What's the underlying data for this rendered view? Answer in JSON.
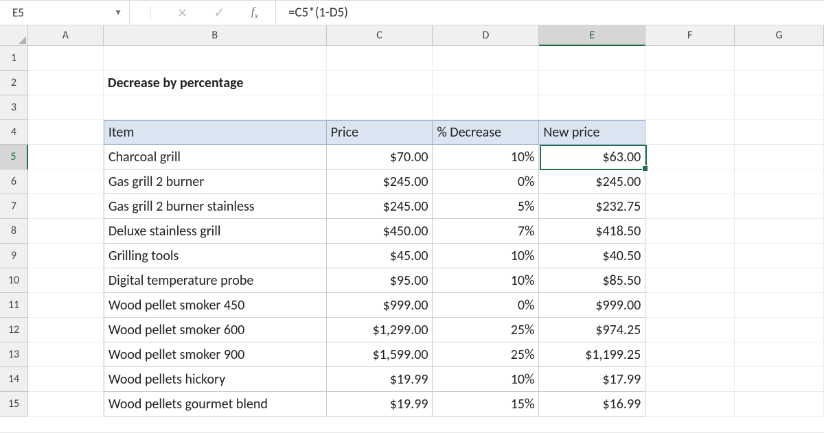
{
  "namebox": {
    "value": "E5"
  },
  "formula_bar": {
    "value": "=C5*(1-D5)"
  },
  "columns": [
    "A",
    "B",
    "C",
    "D",
    "E",
    "F",
    "G"
  ],
  "rows": [
    "1",
    "2",
    "3",
    "4",
    "5",
    "6",
    "7",
    "8",
    "9",
    "10",
    "11",
    "12",
    "13",
    "14",
    "15"
  ],
  "selected_column": "E",
  "selected_row": "5",
  "title": "Decrease by percentage",
  "table": {
    "headers": {
      "item": "Item",
      "price": "Price",
      "decrease": "% Decrease",
      "newprice": "New price"
    },
    "rows": [
      {
        "item": "Charcoal grill",
        "price": "$70.00",
        "decrease": "10%",
        "newprice": "$63.00"
      },
      {
        "item": "Gas grill 2 burner",
        "price": "$245.00",
        "decrease": "0%",
        "newprice": "$245.00"
      },
      {
        "item": "Gas grill 2 burner stainless",
        "price": "$245.00",
        "decrease": "5%",
        "newprice": "$232.75"
      },
      {
        "item": "Deluxe stainless grill",
        "price": "$450.00",
        "decrease": "7%",
        "newprice": "$418.50"
      },
      {
        "item": "Grilling tools",
        "price": "$45.00",
        "decrease": "10%",
        "newprice": "$40.50"
      },
      {
        "item": "Digital temperature probe",
        "price": "$95.00",
        "decrease": "10%",
        "newprice": "$85.50"
      },
      {
        "item": "Wood pellet smoker 450",
        "price": "$999.00",
        "decrease": "0%",
        "newprice": "$999.00"
      },
      {
        "item": "Wood pellet smoker 600",
        "price": "$1,299.00",
        "decrease": "25%",
        "newprice": "$974.25"
      },
      {
        "item": "Wood pellet smoker 900",
        "price": "$1,599.00",
        "decrease": "25%",
        "newprice": "$1,199.25"
      },
      {
        "item": "Wood pellets hickory",
        "price": "$19.99",
        "decrease": "10%",
        "newprice": "$17.99"
      },
      {
        "item": "Wood pellets gourmet blend",
        "price": "$19.99",
        "decrease": "15%",
        "newprice": "$16.99"
      }
    ]
  }
}
